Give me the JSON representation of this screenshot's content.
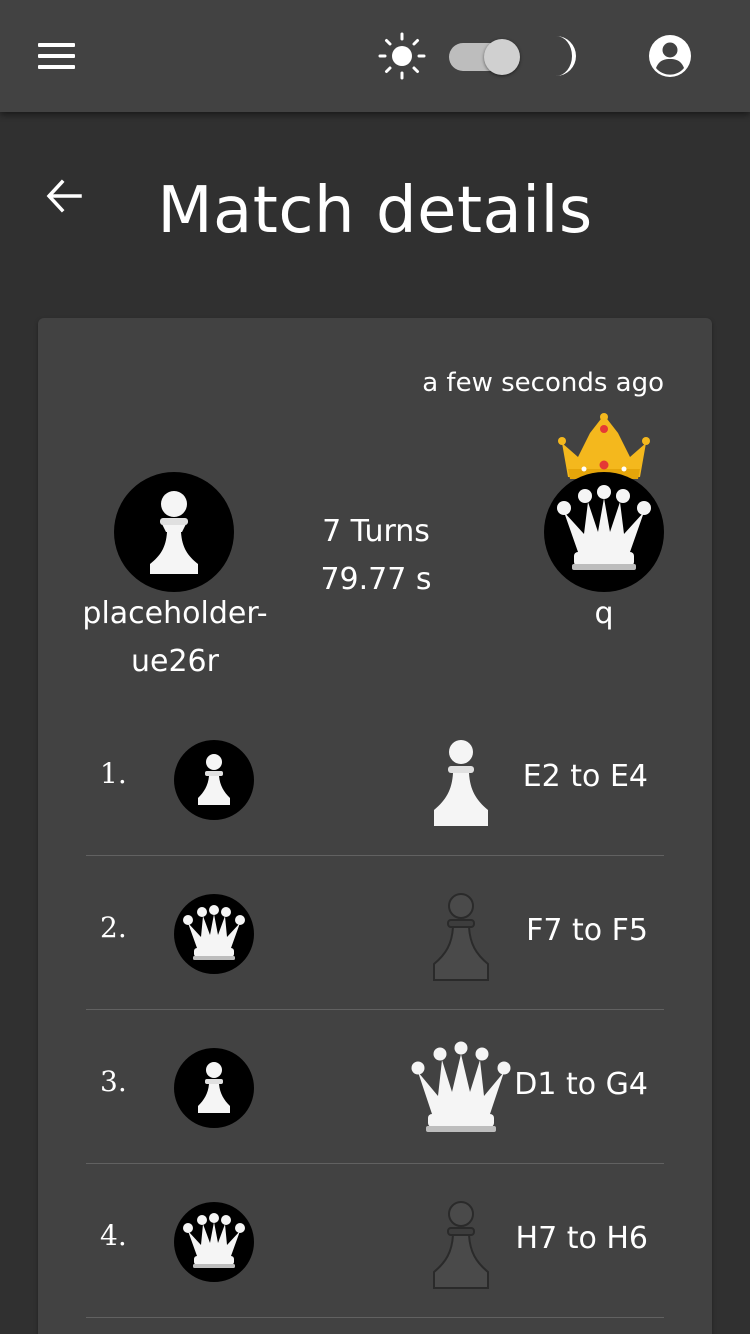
{
  "header": {
    "menu_icon": "menu-icon",
    "theme_light_icon": "sun-icon",
    "theme_dark_icon": "moon-icon",
    "account_icon": "account-circle-icon"
  },
  "page": {
    "back_icon": "arrow-back-icon",
    "title": "Match details"
  },
  "match": {
    "timestamp": "a few seconds ago",
    "player_left": {
      "name": "placeholder-ue26r",
      "avatar": "white-pawn"
    },
    "player_right": {
      "name": "q",
      "avatar": "white-queen",
      "winner": true
    },
    "turns": "7 Turns",
    "duration": "79.77 s"
  },
  "moves": [
    {
      "number": "1.",
      "player_avatar": "white-pawn",
      "piece": "white-pawn",
      "text": "E2 to E4"
    },
    {
      "number": "2.",
      "player_avatar": "white-queen",
      "piece": "black-pawn",
      "text": "F7 to F5"
    },
    {
      "number": "3.",
      "player_avatar": "white-pawn",
      "piece": "white-queen",
      "text": "D1 to G4"
    },
    {
      "number": "4.",
      "player_avatar": "white-queen",
      "piece": "black-pawn",
      "text": "H7 to H6"
    }
  ],
  "colors": {
    "appbar": "#424242",
    "background": "#303030",
    "card": "#424242",
    "crown_gold": "#f4b81d",
    "white_piece": "#f5f5f5",
    "black_piece": "#4a4a4a"
  }
}
